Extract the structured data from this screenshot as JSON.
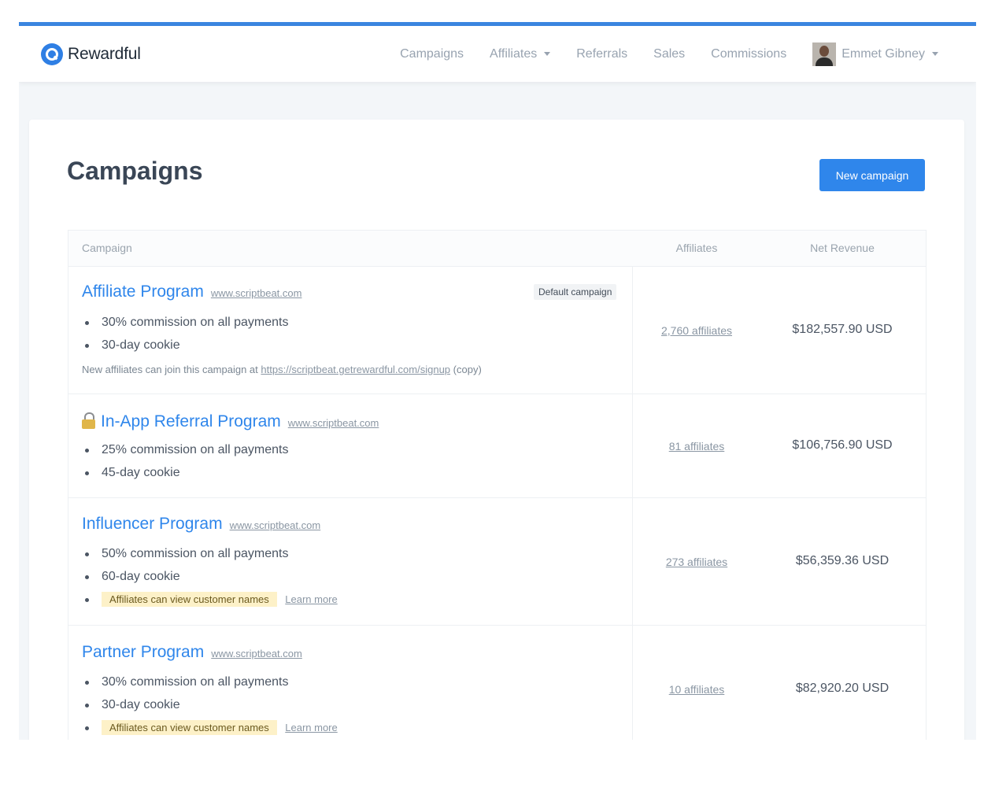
{
  "brand": {
    "name": "Rewardful"
  },
  "nav": {
    "items": [
      {
        "label": "Campaigns"
      },
      {
        "label": "Affiliates",
        "dropdown": true
      },
      {
        "label": "Referrals"
      },
      {
        "label": "Sales"
      },
      {
        "label": "Commissions"
      }
    ],
    "user": {
      "name": "Emmet Gibney"
    }
  },
  "page": {
    "title": "Campaigns",
    "new_button_label": "New campaign"
  },
  "table": {
    "headers": {
      "campaign": "Campaign",
      "affiliates": "Affiliates",
      "revenue": "Net Revenue"
    },
    "rows": [
      {
        "name": "Affiliate Program",
        "site": "www.scriptbeat.com",
        "badge": "Default campaign",
        "bullets": [
          "30% commission on all payments",
          "30-day cookie"
        ],
        "join_text": "New affiliates can join this campaign at",
        "join_url": "https://scriptbeat.getrewardful.com/signup",
        "join_copy": "(copy)",
        "affiliates": "2,760 affiliates",
        "revenue": "$182,557.90 USD"
      },
      {
        "name": "In-App Referral Program",
        "site": "www.scriptbeat.com",
        "locked": true,
        "bullets": [
          "25% commission on all payments",
          "45-day cookie"
        ],
        "affiliates": "81 affiliates",
        "revenue": "$106,756.90 USD"
      },
      {
        "name": "Influencer Program",
        "site": "www.scriptbeat.com",
        "bullets": [
          "50% commission on all payments",
          "60-day cookie"
        ],
        "flag": "Affiliates can view customer names",
        "learn_more": "Learn more",
        "affiliates": "273 affiliates",
        "revenue": "$56,359.36 USD"
      },
      {
        "name": "Partner Program",
        "site": "www.scriptbeat.com",
        "bullets": [
          "30% commission on all payments",
          "30-day cookie"
        ],
        "flag": "Affiliates can view customer names",
        "learn_more": "Learn more",
        "affiliates": "10 affiliates",
        "revenue": "$82,920.20 USD"
      }
    ]
  },
  "colors": {
    "accent": "#2f86eb",
    "topbar": "#3b86e0",
    "flag_bg": "#fdf1c8"
  }
}
